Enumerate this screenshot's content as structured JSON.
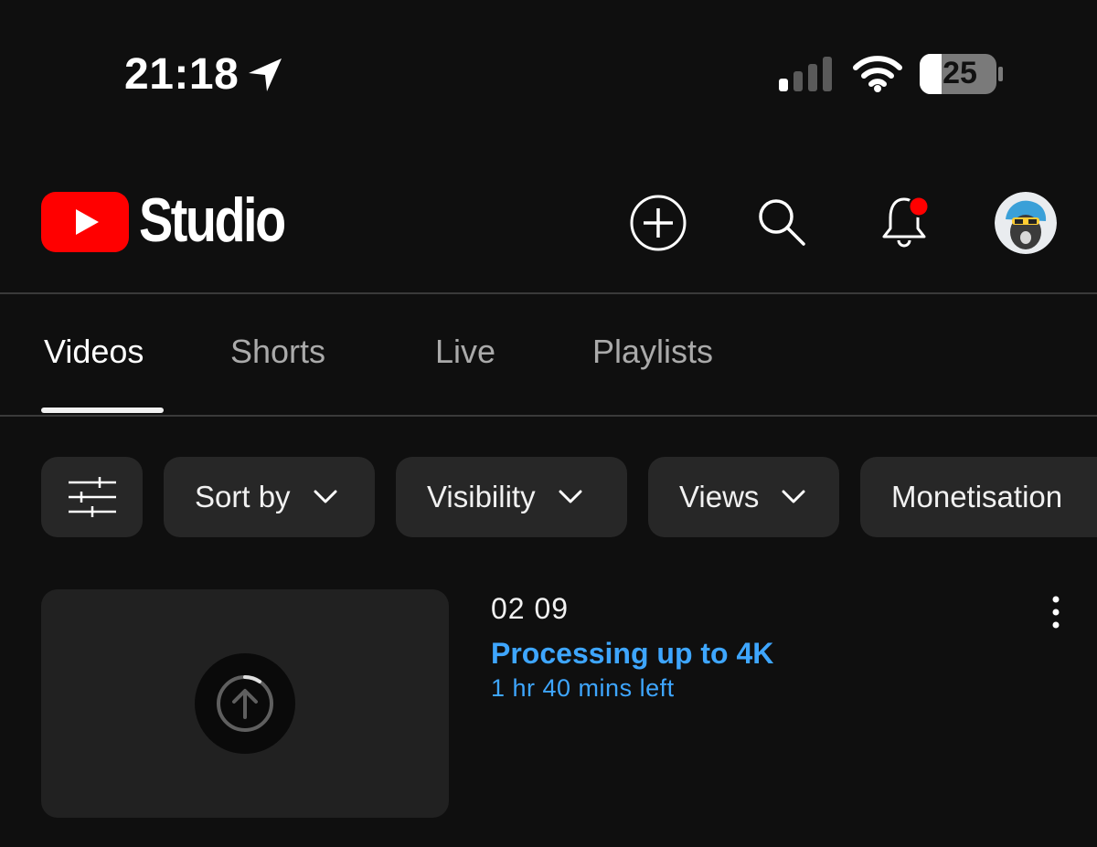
{
  "status_bar": {
    "time": "21:18",
    "battery_level": "25",
    "icons": [
      "location-arrow-icon",
      "cellular-signal-icon",
      "wifi-icon",
      "battery-icon"
    ]
  },
  "header": {
    "brand": "Studio",
    "logo_icon": "youtube-logo-icon",
    "actions": [
      "create-icon",
      "search-icon",
      "notification-bell-icon",
      "account-avatar"
    ],
    "has_notification_dot": true
  },
  "tabs": [
    {
      "label": "Videos",
      "active": true
    },
    {
      "label": "Shorts",
      "active": false
    },
    {
      "label": "Live",
      "active": false
    },
    {
      "label": "Playlists",
      "active": false
    }
  ],
  "filters": {
    "filter_icon": "filter-sliders-icon",
    "chips": [
      {
        "label": "Sort by"
      },
      {
        "label": "Visibility"
      },
      {
        "label": "Views"
      },
      {
        "label": "Monetisation"
      }
    ]
  },
  "video": {
    "title": "02 09",
    "status": "Processing up to 4K",
    "time_left": "1 hr 40 mins left",
    "thumbnail_icon": "upload-progress-icon",
    "menu_icon": "more-vertical-icon"
  },
  "colors": {
    "background": "#0f0f0f",
    "brand_red": "#ff0000",
    "link_blue": "#3ea6ff",
    "chip_bg": "#272727",
    "notification_red": "#ff0000"
  }
}
